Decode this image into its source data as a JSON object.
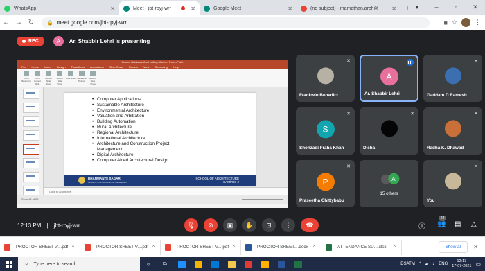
{
  "browser": {
    "tabs": [
      {
        "label": "WhatsApp",
        "color": "#25d366",
        "active": false
      },
      {
        "label": "Meet - jbt-rpyj-wrr",
        "color": "#00897b",
        "active": true
      },
      {
        "label": "Google Meet",
        "color": "#00897b",
        "active": false
      },
      {
        "label": "(no subject) - mamathan.arch@",
        "color": "#ea4335",
        "active": false
      }
    ],
    "url": "meet.google.com/jbt-rpyj-wrr"
  },
  "meet": {
    "rec_label": "REC",
    "presenter_initial": "A",
    "presenting_text": "Ar. Shabbir Lehri is presenting",
    "time": "12:13 PM",
    "separator": "|",
    "meeting_code": "jbt-rpyj-wrr",
    "participant_count": "24",
    "colors": {
      "accent_red": "#ea4335",
      "active_border": "#8ab4f8"
    }
  },
  "presentation": {
    "app_title": "Career Guidance final editing Marks – PowerPoint",
    "menu": [
      "File",
      "Home",
      "Insert",
      "Design",
      "Transitions",
      "Animations",
      "Slide Show",
      "Review",
      "View",
      "Recording",
      "Help"
    ],
    "ribbon_buttons": [
      "From Beginning",
      "From Current Slide",
      "Custom Slide Show",
      "Set Up Slide Show",
      "Hide Slide",
      "Rehearse Timings",
      "Record Slide Show"
    ],
    "bullets": [
      "Computer Applications",
      "Sustainable Architecture",
      "Environmental Architecture",
      "Valuation and Arbitration",
      "Building Automation",
      "Rural Architecture",
      "Regional Architecture",
      "International Architecture",
      "Architecture and Construction Project",
      "Management",
      "Digital Architecture",
      "Computer Aided Architectural Design"
    ],
    "footer_school": "DHANWANTE SAGAR",
    "footer_school_sub": "Academy of Architecture and Management",
    "footer_campus_line1": "SCHOOL OF ARCHITECTURE",
    "footer_campus_line2": "CAMPUS 2",
    "notes_placeholder": "Click to add notes",
    "status_text": "Slide 48 of 55"
  },
  "participants": [
    {
      "name": "Frankwin Benedict",
      "kind": "photo",
      "color": "#b7b0a4",
      "muted": true
    },
    {
      "name": "Ar. Shabbir Lehri",
      "kind": "initial",
      "initial": "A",
      "color": "#e8709a",
      "muted": false,
      "active": true
    },
    {
      "name": "Gaddam D Ramesh",
      "kind": "photo",
      "color": "#3b6fb0",
      "muted": true
    },
    {
      "name": "Shohzadi Fraha Khan",
      "kind": "initial",
      "initial": "S",
      "color": "#12a4af",
      "muted": true
    },
    {
      "name": "Disha",
      "kind": "photo",
      "color": "#050505",
      "muted": true
    },
    {
      "name": "Radha K. Dhawad",
      "kind": "photo",
      "color": "#c9703a",
      "muted": true
    },
    {
      "name": "Praseetha Chittybabu",
      "kind": "initial",
      "initial": "P",
      "color": "#f57c00",
      "muted": true
    },
    {
      "name": "15 others",
      "kind": "others",
      "initial": "A",
      "color": "#34a853",
      "muted": false
    },
    {
      "name": "You",
      "kind": "photo",
      "color": "#c8b89a",
      "muted": true
    }
  ],
  "downloads": [
    {
      "label": "PROCTOR SHEET V....pdf",
      "color": "#ea4335"
    },
    {
      "label": "PROCTOR SHEET V....pdf",
      "color": "#ea4335"
    },
    {
      "label": "PROCTOR SHEET V....pdf",
      "color": "#ea4335"
    },
    {
      "label": "PROCTOR SHEET....docx",
      "color": "#2b579a"
    },
    {
      "label": "ATTENDANCE SU....xlsx",
      "color": "#217346"
    }
  ],
  "downloads_show_all": "Show all",
  "taskbar": {
    "search_placeholder": "Type here to search",
    "apps": [
      {
        "name": "edge",
        "color": "#1e90ff"
      },
      {
        "name": "chrome",
        "color": "#f4b400"
      },
      {
        "name": "mail",
        "color": "#0078d4"
      },
      {
        "name": "explorer",
        "color": "#f2c94c"
      },
      {
        "name": "acrobat",
        "color": "#e53935"
      },
      {
        "name": "store",
        "color": "#ffb300"
      },
      {
        "name": "word",
        "color": "#2b579a"
      },
      {
        "name": "excel",
        "color": "#217346"
      }
    ],
    "tray_text": "DSATM",
    "language": "ENG",
    "time": "12:13",
    "date": "17-07-2021"
  }
}
